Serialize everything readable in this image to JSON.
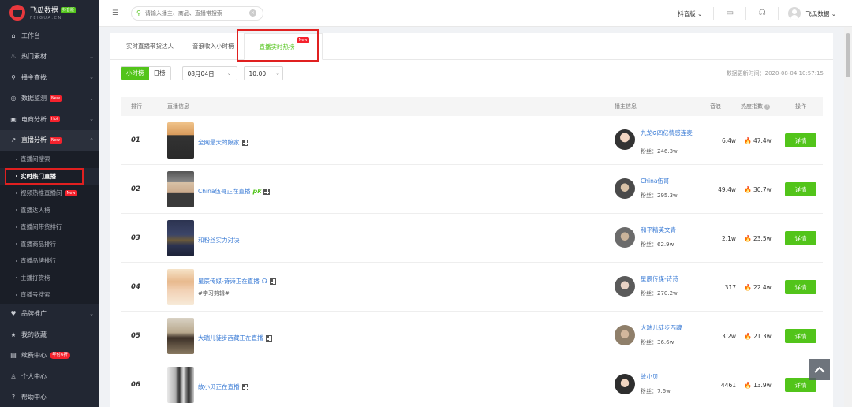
{
  "brand": {
    "name": "飞瓜数据",
    "badge": "抖音版",
    "sub": "FEIGUA.CN"
  },
  "sidebar": {
    "items": [
      {
        "label": "工作台",
        "icon": "home-icon"
      },
      {
        "label": "热门素材",
        "icon": "fire-icon"
      },
      {
        "label": "播主查找",
        "icon": "search-icon"
      },
      {
        "label": "数据监测",
        "icon": "monitor-icon",
        "tag": "New"
      },
      {
        "label": "电商分析",
        "icon": "shop-icon",
        "tag": "Hot"
      },
      {
        "label": "直播分析",
        "icon": "live-chart-icon",
        "tag": "New"
      }
    ],
    "subitems": [
      {
        "label": "直播间搜索"
      },
      {
        "label": "实时热门直播"
      },
      {
        "label": "视频热推直播间",
        "tag": "New"
      },
      {
        "label": "直播达人榜"
      },
      {
        "label": "直播间带货排行"
      },
      {
        "label": "直播商品排行"
      },
      {
        "label": "直播品牌排行"
      },
      {
        "label": "主播打赏榜"
      },
      {
        "label": "直播号搜索"
      }
    ],
    "bottom": [
      {
        "label": "品牌推广",
        "icon": "brand-icon"
      },
      {
        "label": "我的收藏",
        "icon": "star-icon"
      },
      {
        "label": "续费中心",
        "icon": "card-icon",
        "tag": "年付6折"
      },
      {
        "label": "个人中心",
        "icon": "user-icon"
      },
      {
        "label": "帮助中心",
        "icon": "help-icon"
      }
    ]
  },
  "topbar": {
    "search_placeholder": "请输入播主、商品、直播带搜索",
    "platform": "抖音版",
    "username": "飞瓜数据"
  },
  "tabs": [
    {
      "label": "实时直播带货达人"
    },
    {
      "label": "音浪收入小时榜"
    },
    {
      "label": "直播实时热榜",
      "tag": "New"
    }
  ],
  "filters": {
    "hourly": "小时榜",
    "daily": "日榜",
    "date": "08月04日",
    "time": "10:00",
    "update_label": "数据更新时间：2020-08-04 10:57:15"
  },
  "table": {
    "headers": {
      "rank": "排行",
      "live": "直播信息",
      "anchor": "播主信息",
      "plays": "音浪",
      "heat": "热度指数",
      "action": "操作"
    },
    "rows": [
      {
        "rank": "01",
        "title": "全网最大的娘家",
        "subtitle": "",
        "anchor": "九龙𝕼四亿情感连麦",
        "fans": "粉丝：246.3w",
        "plays": "6.4w",
        "heat": "47.4w",
        "btn": "详情"
      },
      {
        "rank": "02",
        "title": "China伍哥正在直播",
        "subtitle": "",
        "anchor": "China伍哥",
        "fans": "粉丝：295.3w",
        "plays": "49.4w",
        "heat": "30.7w",
        "btn": "详情",
        "pk": "pk"
      },
      {
        "rank": "03",
        "title": "和粉丝实力对决",
        "subtitle": "",
        "anchor": "和平精英文青",
        "fans": "粉丝：62.9w",
        "plays": "2.1w",
        "heat": "23.5w",
        "btn": "详情"
      },
      {
        "rank": "04",
        "title": "星辰传媒-诗诗正在直播",
        "subtitle": "#学习剪辑#",
        "anchor": "星辰传媒-诗诗",
        "fans": "粉丝：270.2w",
        "plays": "317",
        "heat": "22.4w",
        "btn": "详情"
      },
      {
        "rank": "05",
        "title": "大瑞儿徒步西藏正在直播",
        "subtitle": "",
        "anchor": "大瑞儿徒步西藏",
        "fans": "粉丝：36.6w",
        "plays": "3.2w",
        "heat": "21.3w",
        "btn": "详情"
      },
      {
        "rank": "06",
        "title": "故小贝正在直播",
        "subtitle": "",
        "anchor": "故小贝",
        "fans": "粉丝：7.6w",
        "plays": "4461",
        "heat": "13.9w",
        "btn": "详情"
      }
    ]
  },
  "colors": {
    "accent": "#52c41a",
    "sidebar": "#222733",
    "highlight_box": "#e02020",
    "link": "#3a7bd5"
  }
}
